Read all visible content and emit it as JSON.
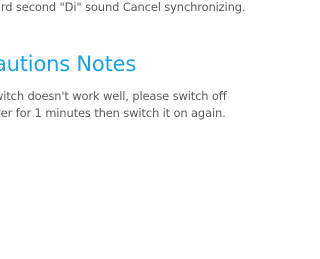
{
  "instructions": {
    "last_line": "ard second \"Di\" sound Cancel synchronizing."
  },
  "precautions": {
    "heading": "autions Notes",
    "lines": [
      "witch doesn't work well, please switch off",
      "ver for 1 minutes then switch it on again."
    ]
  }
}
